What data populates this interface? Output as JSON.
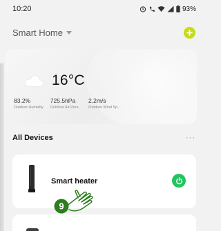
{
  "status_bar": {
    "time": "10:20",
    "battery": "93%"
  },
  "header": {
    "home_name": "Smart Home"
  },
  "weather": {
    "temperature": "16°C",
    "metrics": [
      {
        "value": "83.2%",
        "label": "Outdoor Humidity"
      },
      {
        "value": "725.5hPa",
        "label": "Outdoor Air Pres..."
      },
      {
        "value": "2.2m/s",
        "label": "Outdoor Wind Sp..."
      }
    ]
  },
  "devices_section": {
    "title": "All Devices",
    "more": "···"
  },
  "devices": [
    {
      "name": "Smart heater",
      "power_color": "#22c55e"
    }
  ],
  "annotation": {
    "step_number": "9"
  },
  "colors": {
    "accent": "#c6dc13",
    "power": "#22c55e",
    "annotation_green": "#2e7d1e"
  }
}
